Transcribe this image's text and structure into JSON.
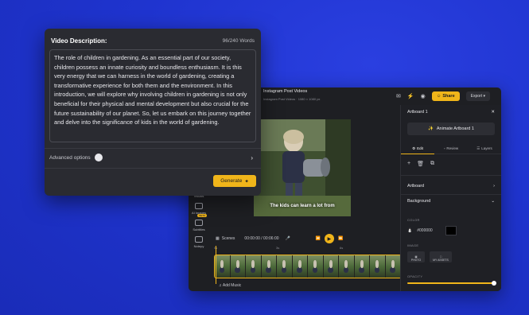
{
  "editor": {
    "project_title": "Instagram Post Videos",
    "project_meta": "Instagram Post Videos · 1080 × 1080 px",
    "share_label": "Share",
    "export_label": "Export",
    "nav": [
      {
        "label": "Visuals",
        "icon": "visuals-icon"
      },
      {
        "label": "AI Images",
        "icon": "ai-images-icon"
      },
      {
        "label": "Subtitles",
        "icon": "subtitles-icon",
        "badge": "BETA"
      },
      {
        "label": "Notepy",
        "icon": "notepy-icon"
      }
    ],
    "caption": "The kids can learn a lot from",
    "scenes_label": "Scenes",
    "time": "00:00:00 / 00:06:00",
    "timeline_ticks": [
      "0s",
      "3s",
      "6s"
    ],
    "add_music_label": "Add Music"
  },
  "panel": {
    "title": "Artboard 1",
    "animate_label": "Animate Artboard 1",
    "tabs": [
      "Edit",
      "Review",
      "Layers"
    ],
    "artboard_label": "Artboard",
    "background_label": "Background",
    "color_label": "COLOR",
    "color_value": "#000000",
    "image_label": "IMAGE",
    "image_buttons": [
      "PHOTO",
      "MY ASSETS"
    ],
    "opacity_label": "OPACITY",
    "opacity_value": 1.0
  },
  "description": {
    "title": "Video Description:",
    "word_count": "96/240 Words",
    "text": "The role of children in gardening. As an essential part of our society, children possess an innate curiosity and boundless enthusiasm. It is this very energy that we can harness in the world of gardening, creating a transformative experience for both them and the environment. In this introduction, we will explore why involving children in gardening is not only beneficial for their physical and mental development but also crucial for the future sustainability of our planet. So, let us embark on this journey together and delve into the significance of kids in the world of gardening.",
    "advanced_label": "Advanced options",
    "generate_label": "Generate"
  },
  "colors": {
    "accent": "#f0b51a",
    "background": "#1f34cf",
    "panel": "#2a2b31"
  }
}
